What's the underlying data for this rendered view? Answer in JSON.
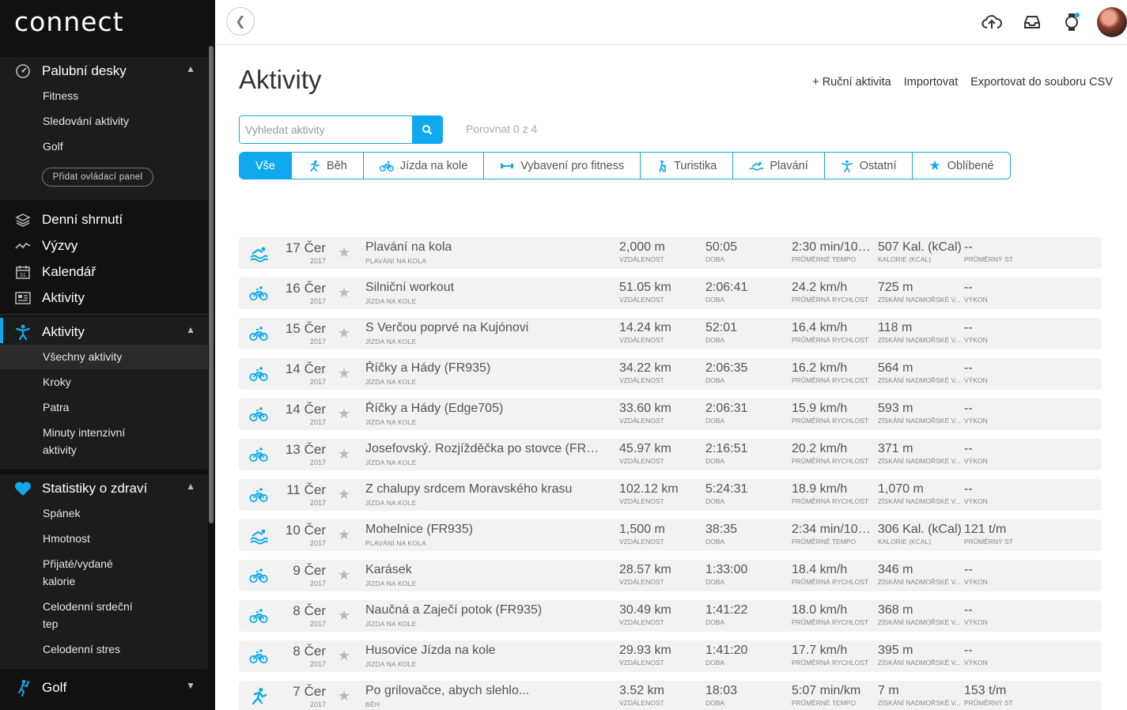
{
  "brand": {
    "logo_text": "connect",
    "accent": "#11a9ed"
  },
  "sidebar": {
    "dashboards": {
      "label": "Palubní desky",
      "icon": "gauge-icon",
      "items": [
        "Fitness",
        "Sledování aktivity",
        "Golf"
      ],
      "add_button": "Přidat ovládací panel"
    },
    "main_items": [
      {
        "label": "Denní shrnutí",
        "icon": "layers-icon"
      },
      {
        "label": "Výzvy",
        "icon": "challenge-icon"
      },
      {
        "label": "Kalendář",
        "icon": "calendar-icon"
      },
      {
        "label": "Aktivity",
        "icon": "newspaper-icon"
      }
    ],
    "activities": {
      "label": "Aktivity",
      "icon": "activity-person-icon",
      "items": [
        "Všechny aktivity",
        "Kroky",
        "Patra",
        "Minuty intenzivní aktivity"
      ]
    },
    "health": {
      "label": "Statistiky o zdraví",
      "icon": "heart-icon",
      "items": [
        "Spánek",
        "Hmotnost",
        "Přijaté/vydané kalorie",
        "Celodenní srdeční tep",
        "Celodenní stres"
      ]
    },
    "golf": {
      "label": "Golf",
      "icon": "golfer-icon"
    }
  },
  "topbar": {
    "icons": [
      "upload-cloud-icon",
      "inbox-icon",
      "watch-icon",
      "avatar"
    ]
  },
  "page": {
    "title": "Aktivity",
    "links": [
      "+ Ruční aktivita",
      "Importovat",
      "Exportovat do souboru CSV"
    ],
    "search_placeholder": "Vyhledat aktivity",
    "compare": "Porovnat 0 z 4",
    "filters": [
      {
        "label": "Vše",
        "icon": ""
      },
      {
        "label": "Běh",
        "icon": "run-icon"
      },
      {
        "label": "Jízda na kole",
        "icon": "bike-icon"
      },
      {
        "label": "Vybavení pro fitness",
        "icon": "dumbbell-icon"
      },
      {
        "label": "Turistika",
        "icon": "hike-icon"
      },
      {
        "label": "Plavání",
        "icon": "swim-icon"
      },
      {
        "label": "Ostatní",
        "icon": "other-icon"
      },
      {
        "label": "Oblíbené",
        "icon": "star-icon"
      }
    ]
  },
  "activities": [
    {
      "type": "swim",
      "day": "17 Čer",
      "year": "2017",
      "name": "Plavání na kola",
      "sub": "PLAVÁNÍ NA KOLA",
      "m": [
        [
          "2,000 m",
          "VZDÁLENOST"
        ],
        [
          "50:05",
          "DOBA"
        ],
        [
          "2:30 min/100 ...",
          "PRŮMĚRNÉ TEMPO"
        ],
        [
          "507 Kal. (kCal)",
          "KALORIE (KCAL)"
        ],
        [
          "--",
          "PRŮMĚRNÝ ST"
        ]
      ]
    },
    {
      "type": "bike",
      "day": "16 Čer",
      "year": "2017",
      "name": "Silniční workout",
      "sub": "JÍZDA NA KOLE",
      "m": [
        [
          "51.05 km",
          "VZDÁLENOST"
        ],
        [
          "2:06:41",
          "DOBA"
        ],
        [
          "24.2 km/h",
          "PRŮMĚRNÁ RYCHLOST"
        ],
        [
          "725 m",
          "ZÍSKÁNÍ NADMOŘSKÉ V..."
        ],
        [
          "--",
          "VÝKON"
        ]
      ]
    },
    {
      "type": "bike",
      "day": "15 Čer",
      "year": "2017",
      "name": "S Verčou poprvé na Kujónovi",
      "sub": "JÍZDA NA KOLE",
      "m": [
        [
          "14.24 km",
          "VZDÁLENOST"
        ],
        [
          "52:01",
          "DOBA"
        ],
        [
          "16.4 km/h",
          "PRŮMĚRNÁ RYCHLOST"
        ],
        [
          "118 m",
          "ZÍSKÁNÍ NADMOŘSKÉ V..."
        ],
        [
          "--",
          "VÝKON"
        ]
      ]
    },
    {
      "type": "bike",
      "day": "14 Čer",
      "year": "2017",
      "name": "Říčky a Hády (FR935)",
      "sub": "JÍZDA NA KOLE",
      "m": [
        [
          "34.22 km",
          "VZDÁLENOST"
        ],
        [
          "2:06:35",
          "DOBA"
        ],
        [
          "16.2 km/h",
          "PRŮMĚRNÁ RYCHLOST"
        ],
        [
          "564 m",
          "ZÍSKÁNÍ NADMOŘSKÉ V..."
        ],
        [
          "--",
          "VÝKON"
        ]
      ]
    },
    {
      "type": "bike",
      "day": "14 Čer",
      "year": "2017",
      "name": "Říčky a Hády (Edge705)",
      "sub": "JÍZDA NA KOLE",
      "m": [
        [
          "33.60 km",
          "VZDÁLENOST"
        ],
        [
          "2:06:31",
          "DOBA"
        ],
        [
          "15.9 km/h",
          "PRŮMĚRNÁ RYCHLOST"
        ],
        [
          "593 m",
          "ZÍSKÁNÍ NADMOŘSKÉ V..."
        ],
        [
          "--",
          "VÝKON"
        ]
      ]
    },
    {
      "type": "bike",
      "day": "13 Čer",
      "year": "2017",
      "name": "Josefovský. Rozjížděčka po stovce (FR93...",
      "sub": "JÍZDA NA KOLE",
      "m": [
        [
          "45.97 km",
          "VZDÁLENOST"
        ],
        [
          "2:16:51",
          "DOBA"
        ],
        [
          "20.2 km/h",
          "PRŮMĚRNÁ RYCHLOST"
        ],
        [
          "371 m",
          "ZÍSKÁNÍ NADMOŘSKÉ V..."
        ],
        [
          "--",
          "VÝKON"
        ]
      ]
    },
    {
      "type": "bike",
      "day": "11 Čer",
      "year": "2017",
      "name": "Z chalupy srdcem Moravského krasu",
      "sub": "JÍZDA NA KOLE",
      "m": [
        [
          "102.12 km",
          "VZDÁLENOST"
        ],
        [
          "5:24:31",
          "DOBA"
        ],
        [
          "18.9 km/h",
          "PRŮMĚRNÁ RYCHLOST"
        ],
        [
          "1,070 m",
          "ZÍSKÁNÍ NADMOŘSKÉ V..."
        ],
        [
          "--",
          "VÝKON"
        ]
      ]
    },
    {
      "type": "swim",
      "day": "10 Čer",
      "year": "2017",
      "name": "Mohelnice (FR935)",
      "sub": "PLAVÁNÍ NA KOLA",
      "m": [
        [
          "1,500 m",
          "VZDÁLENOST"
        ],
        [
          "38:35",
          "DOBA"
        ],
        [
          "2:34 min/100 ...",
          "PRŮMĚRNÉ TEMPO"
        ],
        [
          "306 Kal. (kCal)",
          "KALORIE (KCAL)"
        ],
        [
          "121 t/m",
          "PRŮMĚRNÝ ST"
        ]
      ]
    },
    {
      "type": "bike",
      "day": "9 Čer",
      "year": "2017",
      "name": "Karásek",
      "sub": "JÍZDA NA KOLE",
      "m": [
        [
          "28.57 km",
          "VZDÁLENOST"
        ],
        [
          "1:33:00",
          "DOBA"
        ],
        [
          "18.4 km/h",
          "PRŮMĚRNÁ RYCHLOST"
        ],
        [
          "346 m",
          "ZÍSKÁNÍ NADMOŘSKÉ V..."
        ],
        [
          "--",
          "VÝKON"
        ]
      ]
    },
    {
      "type": "bike",
      "day": "8 Čer",
      "year": "2017",
      "name": "Naučná a Zaječí potok (FR935)",
      "sub": "JÍZDA NA KOLE",
      "m": [
        [
          "30.49 km",
          "VZDÁLENOST"
        ],
        [
          "1:41:22",
          "DOBA"
        ],
        [
          "18.0 km/h",
          "PRŮMĚRNÁ RYCHLOST"
        ],
        [
          "368 m",
          "ZÍSKÁNÍ NADMOŘSKÉ V..."
        ],
        [
          "--",
          "VÝKON"
        ]
      ]
    },
    {
      "type": "bike",
      "day": "8 Čer",
      "year": "2017",
      "name": "Husovice Jízda na kole",
      "sub": "JÍZDA NA KOLE",
      "m": [
        [
          "29.93 km",
          "VZDÁLENOST"
        ],
        [
          "1:41:20",
          "DOBA"
        ],
        [
          "17.7 km/h",
          "PRŮMĚRNÁ RYCHLOST"
        ],
        [
          "395 m",
          "ZÍSKÁNÍ NADMOŘSKÉ V..."
        ],
        [
          "--",
          "VÝKON"
        ]
      ]
    },
    {
      "type": "run",
      "day": "7 Čer",
      "year": "2017",
      "name": "Po grilovačce, abych slehlo...",
      "sub": "BĚH",
      "m": [
        [
          "3.52 km",
          "VZDÁLENOST"
        ],
        [
          "18:03",
          "DOBA"
        ],
        [
          "5:07 min/km",
          "PRŮMĚRNÉ TEMPO"
        ],
        [
          "7 m",
          "ZÍSKÁNÍ NADMOŘSKÉ V..."
        ],
        [
          "153 t/m",
          "PRŮMĚRNÝ ST"
        ]
      ]
    }
  ]
}
